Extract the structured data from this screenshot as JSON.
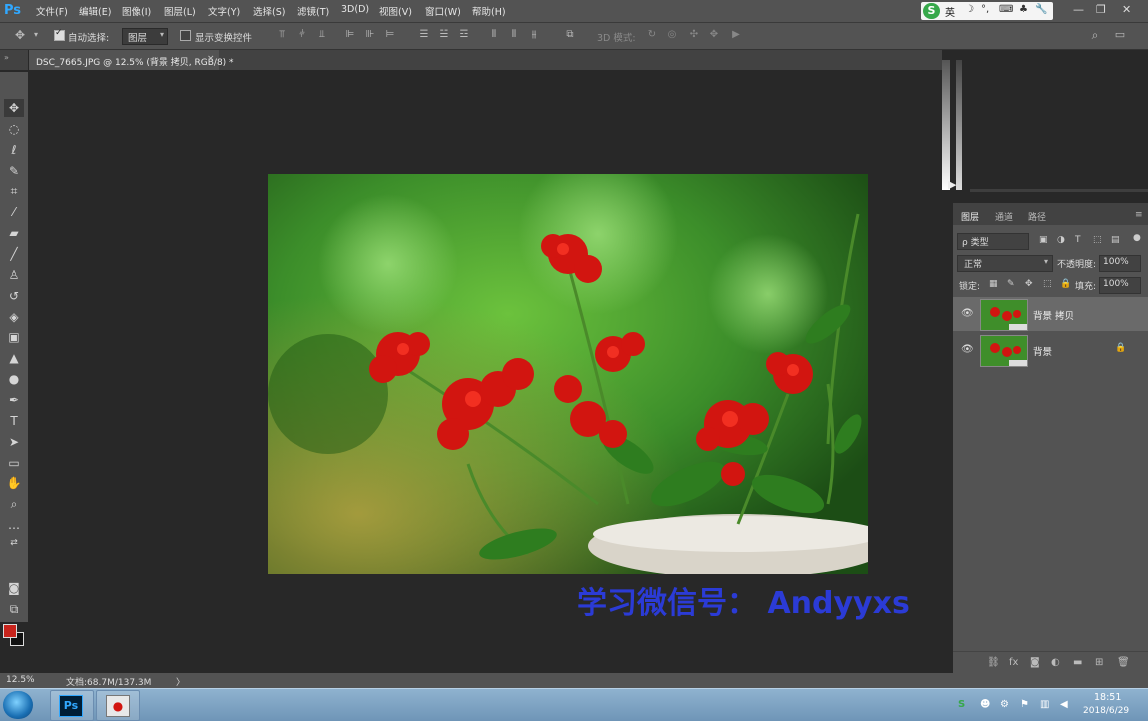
{
  "app": {
    "logo": "Ps"
  },
  "menu": [
    "文件(F)",
    "编辑(E)",
    "图像(I)",
    "图层(L)",
    "文字(Y)",
    "选择(S)",
    "滤镜(T)",
    "3D(D)",
    "视图(V)",
    "窗口(W)",
    "帮助(H)"
  ],
  "ime": {
    "logo": "S",
    "lang": "英",
    "symbols": [
      "☽",
      "°,",
      "⌨",
      "♣",
      "🔧"
    ]
  },
  "window_controls": [
    "—",
    "❐",
    "✕"
  ],
  "options": {
    "auto_select_label": "自动选择:",
    "auto_select_checked": true,
    "auto_select_value": "图层",
    "transform_label": "显示变换控件",
    "transform_checked": false,
    "mode_3d_label": "3D 模式:"
  },
  "document": {
    "tab_title": "DSC_7665.JPG @ 12.5% (背景 拷贝, RGB/8) *",
    "close": "×"
  },
  "watermark": "学习微信号： Andyyxs",
  "tools": [
    "move-tool",
    "marquee-tool",
    "lasso-tool",
    "quick-select-tool",
    "crop-tool",
    "eyedropper-tool",
    "healing-brush-tool",
    "brush-tool",
    "clone-stamp-tool",
    "history-brush-tool",
    "eraser-tool",
    "gradient-tool",
    "blur-tool",
    "dodge-tool",
    "pen-tool",
    "type-tool",
    "path-select-tool",
    "rectangle-tool",
    "hand-tool",
    "zoom-tool",
    "more-tools"
  ],
  "colors": {
    "foreground": "#c8241c",
    "background": "#111111"
  },
  "layers_panel": {
    "tabs": [
      "图层",
      "通道",
      "路径"
    ],
    "filter_label": "ρ 类型",
    "blend_mode": "正常",
    "opacity_label": "不透明度:",
    "opacity_value": "100%",
    "lock_label": "锁定:",
    "fill_label": "填充:",
    "fill_value": "100%",
    "layers": [
      {
        "name": "背景 拷贝",
        "selected": true,
        "locked": false
      },
      {
        "name": "背景",
        "selected": false,
        "locked": true
      }
    ],
    "footer_icons": [
      "link-icon",
      "fx-icon",
      "mask-icon",
      "adjustment-icon",
      "group-icon",
      "new-layer-icon",
      "delete-icon"
    ]
  },
  "status": {
    "zoom": "12.5%",
    "doc": "文档:68.7M/137.3M",
    "arrow": "〉"
  },
  "taskbar": {
    "apps": [
      "Ps",
      "●"
    ],
    "time": "18:51",
    "date": "2018/6/29"
  }
}
